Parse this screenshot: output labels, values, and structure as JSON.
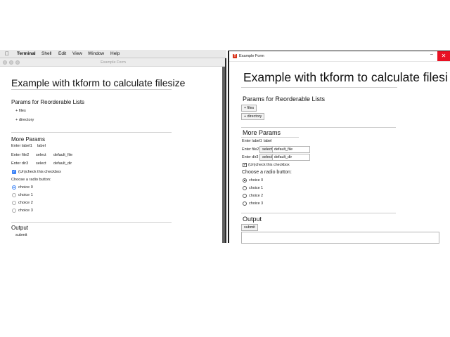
{
  "mac_menubar": {
    "items": [
      "Terminal",
      "Shell",
      "Edit",
      "View",
      "Window",
      "Help"
    ]
  },
  "mac_window": {
    "title": "Example Form",
    "heading": "Example with tkform to calculate filesize",
    "reorderable_title": "Params for Reorderable Lists",
    "files_button": "+ files",
    "directory_button": "+ directory",
    "more_params_title": "More Params",
    "label1_prompt": "Enter label1",
    "label1_value": "label",
    "file2_prompt": "Enter file2",
    "file2_select": "select",
    "file2_value": "default_file",
    "dir3_prompt": "Enter dir3",
    "dir3_select": "select",
    "dir3_value": "default_dir",
    "checkbox_label": "(Un)check this checkbox",
    "radio_prompt": "Choose a radio button:",
    "radio_options": [
      "choice 0",
      "choice 1",
      "choice 2",
      "choice 3"
    ],
    "output_title": "Output",
    "submit_button": "submit"
  },
  "win_window": {
    "title": "Example Form",
    "close_glyph": "✕",
    "minimize_glyph": "–",
    "heading": "Example with tkform to calculate filesi",
    "reorderable_title": "Params for Reorderable Lists",
    "files_button": "+ files",
    "directory_button": "+ directory",
    "more_params_title": "More Params",
    "label1_prompt": "Enter label1",
    "label1_value": "label",
    "file2_prompt": "Enter file2",
    "file2_select": "select",
    "file2_value": "default_file",
    "dir3_prompt": "Enter dir3",
    "dir3_select": "select",
    "dir3_value": "default_dir",
    "checkbox_label": "(Un)check this checkbox",
    "radio_prompt": "Choose a radio button:",
    "radio_options": [
      "choice 0",
      "choice 1",
      "choice 2",
      "choice 3"
    ],
    "output_title": "Output",
    "submit_button": "submit"
  }
}
